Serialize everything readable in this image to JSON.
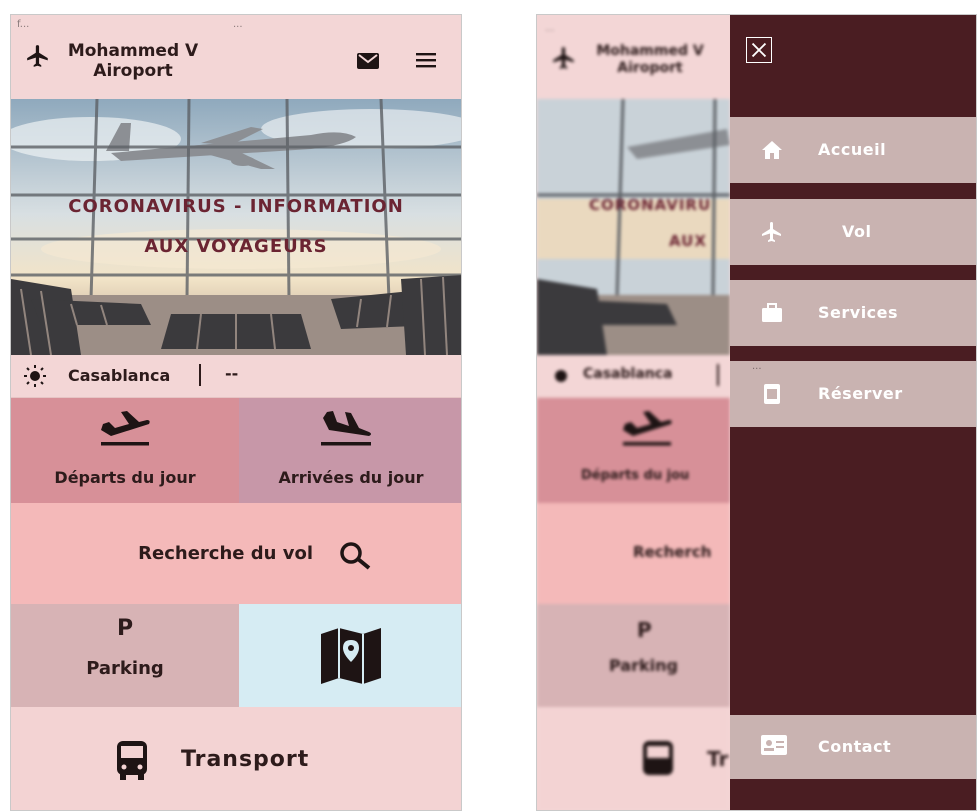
{
  "app": {
    "status_left": "f...",
    "status_center": "...",
    "title_line1": "Mohammed V",
    "title_line2": "Airoport"
  },
  "hero": {
    "line1": "CORONAVIRUS - INFORMATION",
    "line2": "AUX VOYAGEURS"
  },
  "weather": {
    "city": "Casablanca",
    "temperature": "--"
  },
  "tiles": {
    "departures": "Départs du jour",
    "arrivals": "Arrivées du jour",
    "search": "Recherche du vol",
    "parking_letter": "P",
    "parking": "Parking",
    "transport": "Transport"
  },
  "drawer": {
    "items": [
      {
        "label": "Accueil",
        "icon": "home-icon"
      },
      {
        "label": "Vol",
        "icon": "plane-icon"
      },
      {
        "label": "Services",
        "icon": "briefcase-icon"
      },
      {
        "label": "Réserver",
        "icon": "ticket-icon"
      }
    ],
    "reserve_hint": "...",
    "contact": "Contact"
  },
  "right_overlay": {
    "status_left": "...",
    "title_line1": "Mohammed V",
    "title_line2": "Airoport",
    "hero_line1": "CORONAVIRU",
    "hero_line2": "AUX",
    "city": "Casablanca",
    "departures": "Départs du jou",
    "search": "Recherch",
    "parking_letter": "P",
    "parking": "Parking",
    "transport": "Tr"
  },
  "colors": {
    "header_bg": "#f3d6d6",
    "departures_bg": "#d79098",
    "arrivals_bg": "#c797a8",
    "search_bg": "#f4b9b9",
    "parking_bg": "#d7b3b5",
    "map_bg": "#d6ecf3",
    "transport_bg": "#f3d3d3",
    "drawer_bg": "#4a1d22",
    "drawer_item_bg": "#c9b3b1",
    "hero_text": "#6b2432"
  }
}
